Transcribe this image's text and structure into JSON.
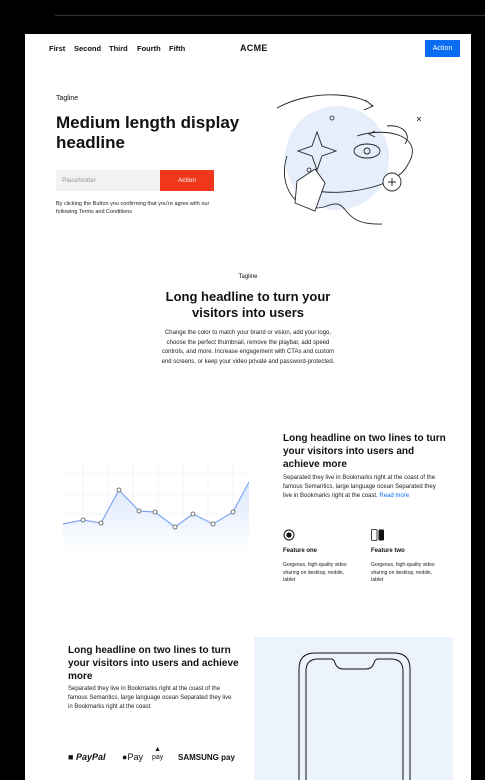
{
  "nav": {
    "links": [
      "First",
      "Second",
      "Third",
      "Fourth",
      "Fifth"
    ],
    "brand": "ACME",
    "action_label": "Action"
  },
  "hero": {
    "tagline": "Tagline",
    "title": "Medium length display headline",
    "input_placeholder": "Placeholder",
    "action_label": "Action",
    "terms": "By clicking the Button you confirming that you're agree with our following Terms and Conditions"
  },
  "section2": {
    "tagline": "Tagline",
    "title": "Long headline to turn your visitors into users",
    "body": "Change the color to match your brand or vision, add your logo, choose the perfect thumbnail, remove the playbar, add speed controls, and more. Increase engagement with CTAs and custom end screens, or keep your video private and password-protected."
  },
  "section3": {
    "title": "Long headline on two lines to turn your visitors into users and achieve more",
    "body": "Separated they live in Bookmarks right at the coast of the famous Semantics, large language ocean Separated they live in Bookmarks right at the coast.",
    "read_more": "Read more",
    "features": [
      {
        "title": "Feature one",
        "desc": "Gorgeous, high-quality video sharing on desktop, mobile, tablet",
        "icon": "target-icon"
      },
      {
        "title": "Feature two",
        "desc": "Gorgeous, high-quality video sharing on desktop, mobile, tablet",
        "icon": "toggle-icon"
      }
    ]
  },
  "section4": {
    "title": "Long headline on two lines to turn your visitors into users and achieve more",
    "body": "Separated they live in Bookmarks right at the coast of the famous Semantics, large language ocean Separated they live in Bookmarks right at the coast",
    "payments": [
      "PayPal",
      "Pay",
      "pay",
      "SAMSUNG pay"
    ]
  },
  "colors": {
    "nav_action": "#0a6cf0",
    "hero_action": "#f0371d",
    "link": "#0a6cf0",
    "panel_bg": "#edf3fd",
    "chart_line": "#7fa8f0"
  }
}
